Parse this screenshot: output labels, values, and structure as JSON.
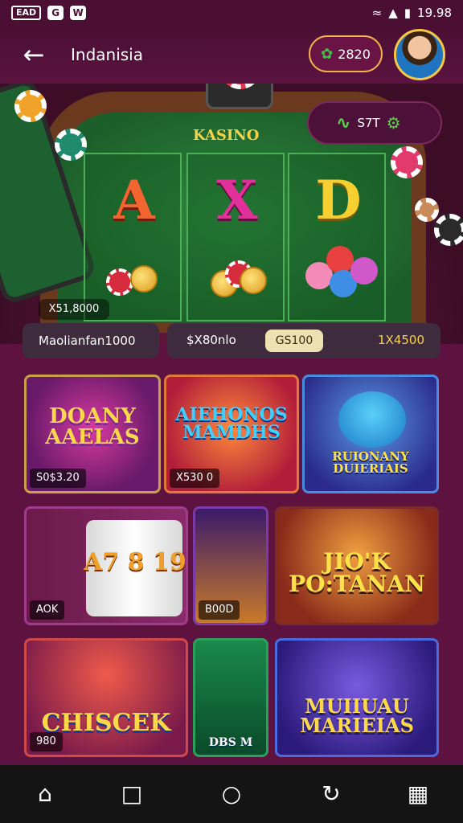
{
  "status_bar": {
    "left_badges": [
      "EAD",
      "G",
      "W"
    ],
    "time": "19.98",
    "wifi_icon": "wifi-icon",
    "signal_icon": "signal-icon",
    "battery_icon": "battery-icon"
  },
  "header": {
    "back_icon": "arrow-left-icon",
    "title": "Indanisia",
    "coins": "2820",
    "avatar_icon": "user-avatar"
  },
  "table": {
    "label": "KASINO",
    "reels": [
      "A",
      "X",
      "D"
    ],
    "balance": "X51,8000",
    "pill_value": "S7T"
  },
  "info_bar": {
    "left": "Maolianfan1000",
    "amount": "$X80nlo",
    "chip": "GS100",
    "total": "1X4500"
  },
  "games": [
    {
      "title": "DOANY AAELAS",
      "badge": "S0$3.20"
    },
    {
      "title": "AIEHONOS MAMDHS",
      "badge": "X530 0"
    },
    {
      "title": "RUIONANY DUIERIAIS",
      "badge": ""
    },
    {
      "title": "A7 8 19",
      "badge": "AOK"
    },
    {
      "title": "",
      "badge": "B00D"
    },
    {
      "title": "JIO'K PO:TANAN",
      "badge": ""
    },
    {
      "title": "CHISCEK",
      "badge": "980"
    },
    {
      "title": "DBS M",
      "badge": ""
    },
    {
      "title": "MUIIUAU MARIEIAS",
      "badge": ""
    }
  ],
  "nav": {
    "items": [
      "home-icon",
      "bookmark-icon",
      "circle-icon",
      "refresh-icon",
      "apps-icon"
    ]
  },
  "colors": {
    "background": "#5e1240",
    "accent_gold": "#f7d24c",
    "felt_green": "#2f8a3e"
  }
}
